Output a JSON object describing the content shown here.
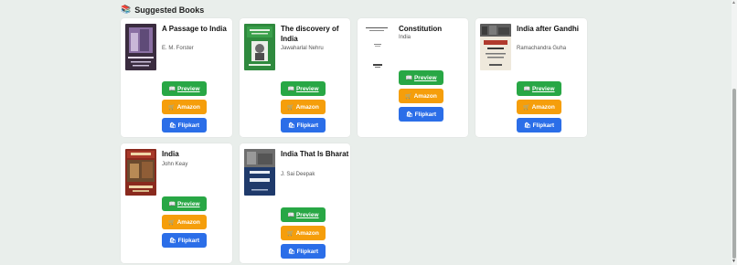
{
  "section": {
    "title": "Suggested Books",
    "icon": "books-icon"
  },
  "buttons": {
    "preview": {
      "label": "Preview",
      "icon": "book-icon"
    },
    "amazon": {
      "label": "Amazon",
      "icon": "cart-icon"
    },
    "flipkart": {
      "label": "Flipkart",
      "icon": "shopping-bag-icon"
    }
  },
  "books": [
    {
      "title": "A Passage to India",
      "author": "E. M. Forster"
    },
    {
      "title": "The discovery of India",
      "author": "Jawaharlal Nehru"
    },
    {
      "title": "Constitution",
      "author": "India"
    },
    {
      "title": "India after Gandhi",
      "author": "Ramachandra Guha"
    },
    {
      "title": "India",
      "author": "John Keay"
    },
    {
      "title": "India That Is Bharat",
      "author": "J. Sai Deepak"
    }
  ],
  "colors": {
    "background": "#e9eeeb",
    "preview": "#28a745",
    "amazon": "#f59e0b",
    "flipkart": "#2b6ee8"
  }
}
